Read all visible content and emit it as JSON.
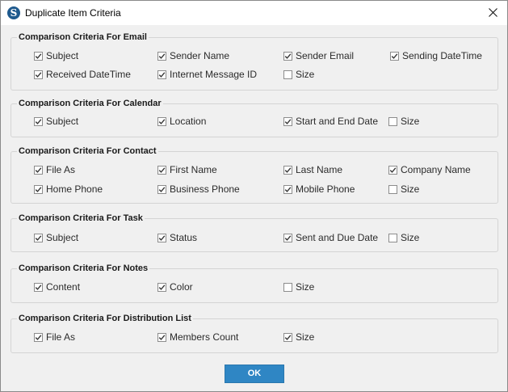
{
  "window": {
    "title": "Duplicate Item Criteria",
    "icon": "stellar-logo-icon",
    "app_icon_letter": "S"
  },
  "groups": [
    {
      "title": "Comparison Criteria For Email",
      "options": [
        {
          "label": "Subject",
          "checked": true
        },
        {
          "label": "Sender Name",
          "checked": true
        },
        {
          "label": "Sender Email",
          "checked": true
        },
        {
          "label": "Sending DateTime",
          "checked": true
        },
        {
          "label": "Received DateTime",
          "checked": true
        },
        {
          "label": "Internet Message ID",
          "checked": true
        },
        {
          "label": "Size",
          "checked": false
        }
      ]
    },
    {
      "title": "Comparison Criteria For Calendar",
      "options": [
        {
          "label": "Subject",
          "checked": true
        },
        {
          "label": "Location",
          "checked": true
        },
        {
          "label": "Start and End Date",
          "checked": true
        },
        {
          "label": "Size",
          "checked": false
        }
      ]
    },
    {
      "title": "Comparison Criteria For Contact",
      "options": [
        {
          "label": "File As",
          "checked": true
        },
        {
          "label": "First Name",
          "checked": true
        },
        {
          "label": "Last Name",
          "checked": true
        },
        {
          "label": "Company Name",
          "checked": true
        },
        {
          "label": "Home Phone",
          "checked": true
        },
        {
          "label": "Business Phone",
          "checked": true
        },
        {
          "label": "Mobile Phone",
          "checked": true
        },
        {
          "label": "Size",
          "checked": false
        }
      ]
    },
    {
      "title": "Comparison Criteria For Task",
      "options": [
        {
          "label": "Subject",
          "checked": true
        },
        {
          "label": "Status",
          "checked": true
        },
        {
          "label": "Sent and Due Date",
          "checked": true
        },
        {
          "label": "Size",
          "checked": false
        }
      ]
    },
    {
      "title": "Comparison Criteria For Notes",
      "options": [
        {
          "label": "Content",
          "checked": true
        },
        {
          "label": "Color",
          "checked": true
        },
        {
          "label": "Size",
          "checked": false
        }
      ]
    },
    {
      "title": "Comparison Criteria For Distribution List",
      "options": [
        {
          "label": "File As",
          "checked": true
        },
        {
          "label": "Members Count",
          "checked": true
        },
        {
          "label": "Size",
          "checked": true
        }
      ]
    }
  ],
  "buttons": {
    "ok_label": "OK"
  },
  "colors": {
    "ok_button": "#2f86c4",
    "checkmark": "#333333",
    "app_icon": "#1f5a8e"
  }
}
